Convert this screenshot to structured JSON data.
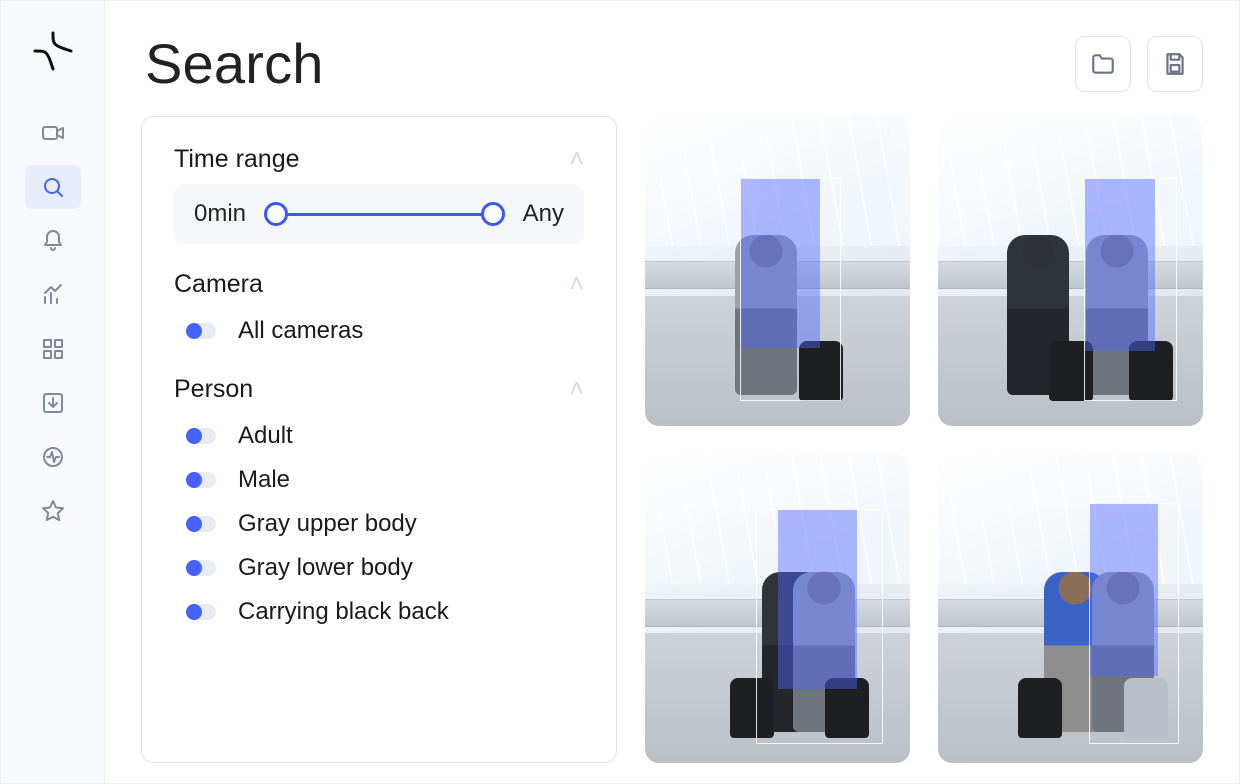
{
  "colors": {
    "accent": "#4763ff"
  },
  "header": {
    "title": "Search"
  },
  "sidebar": {
    "items": [
      {
        "id": "video",
        "icon": "video-icon",
        "active": false
      },
      {
        "id": "search",
        "icon": "search-icon",
        "active": true
      },
      {
        "id": "alerts",
        "icon": "bell-icon",
        "active": false
      },
      {
        "id": "analytics",
        "icon": "chart-icon",
        "active": false
      },
      {
        "id": "grid",
        "icon": "grid-icon",
        "active": false
      },
      {
        "id": "download",
        "icon": "download-icon",
        "active": false
      },
      {
        "id": "activity",
        "icon": "pulse-icon",
        "active": false
      },
      {
        "id": "favorites",
        "icon": "star-icon",
        "active": false
      }
    ]
  },
  "top_actions": {
    "folder_tooltip": "Open",
    "save_tooltip": "Save"
  },
  "filters": {
    "time_range": {
      "title": "Time range",
      "min_label": "0min",
      "max_label": "Any"
    },
    "camera": {
      "title": "Camera",
      "items": [
        {
          "label": "All cameras"
        }
      ]
    },
    "person": {
      "title": "Person",
      "items": [
        {
          "label": "Adult"
        },
        {
          "label": "Male"
        },
        {
          "label": "Gray upper body"
        },
        {
          "label": "Gray lower body"
        },
        {
          "label": "Carrying black back"
        }
      ]
    }
  },
  "results": {
    "count": 4
  }
}
